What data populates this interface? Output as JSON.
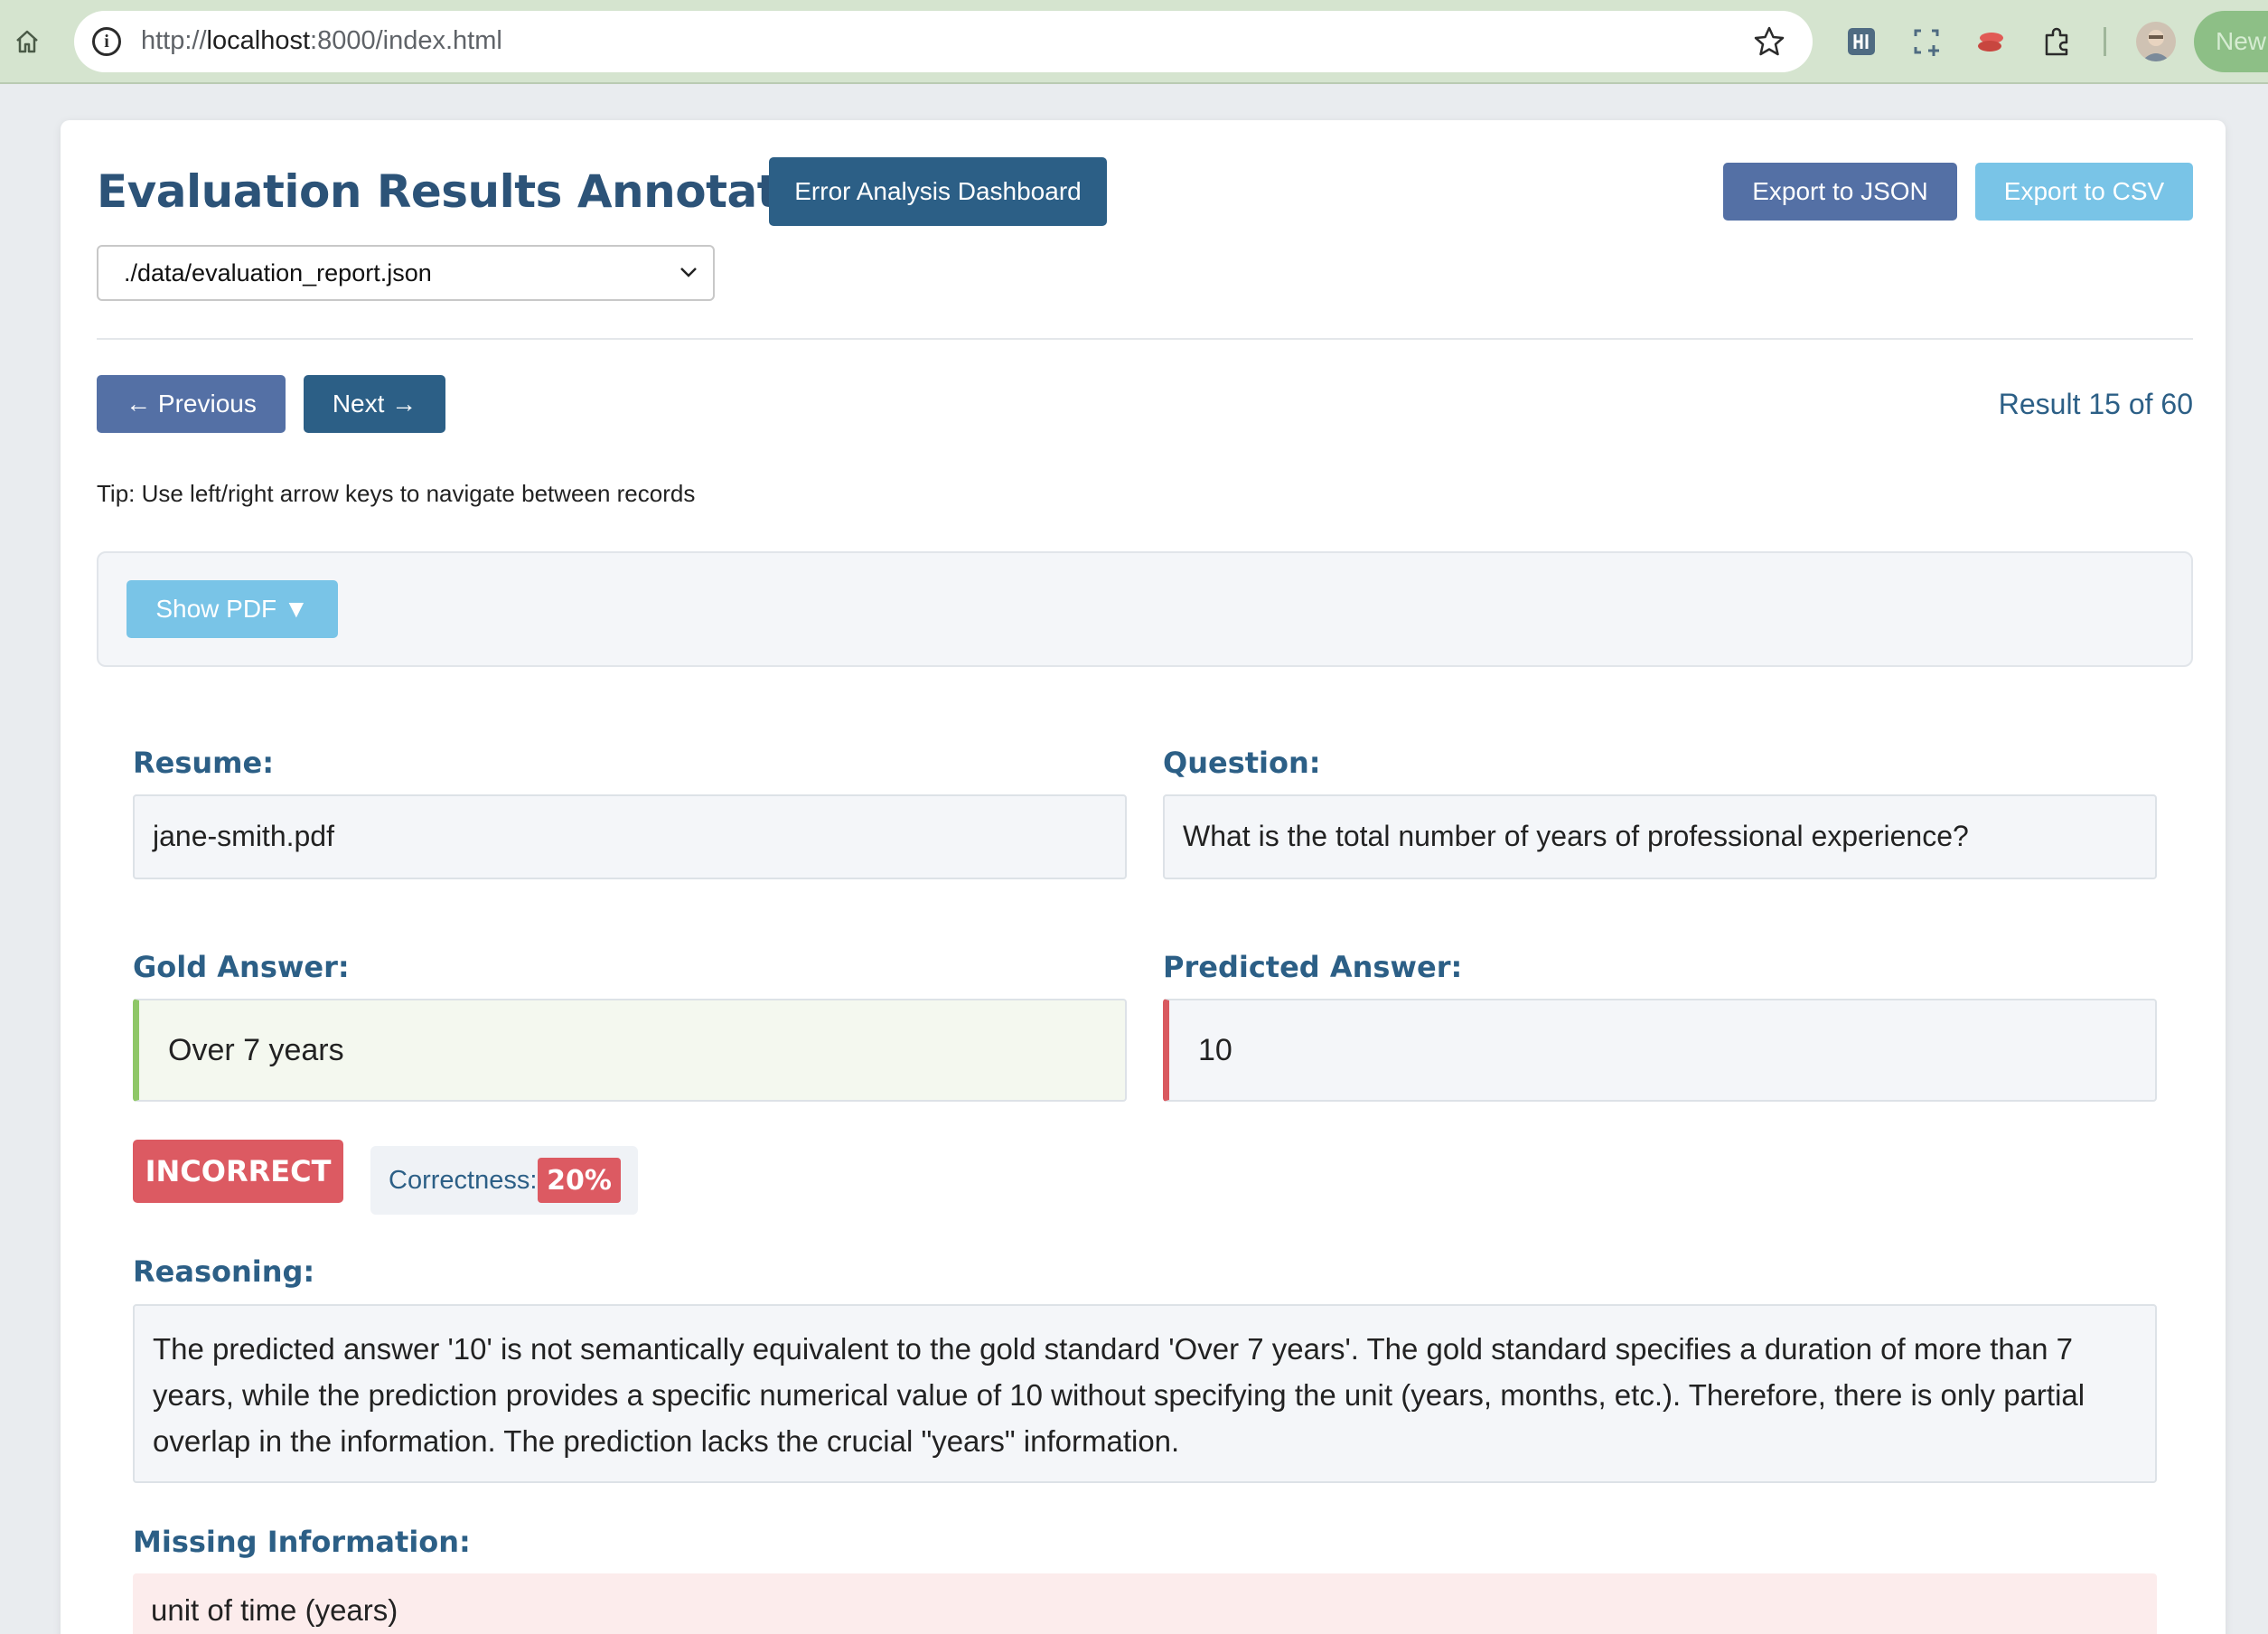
{
  "browser": {
    "url_prefix": "http://",
    "url_host": "localhost",
    "url_rest": ":8000/index.html",
    "new_tab_label": "New"
  },
  "app": {
    "title": "Evaluation Results Annotator",
    "dashboard_button": "Error Analysis Dashboard",
    "export_json": "Export to JSON",
    "export_csv": "Export to CSV",
    "file_select_value": "./data/evaluation_report.json"
  },
  "nav": {
    "previous": "← Previous",
    "next": "Next →",
    "counter": "Result 15 of 60",
    "tip": "Tip: Use left/right arrow keys to navigate between records"
  },
  "pdf": {
    "show_label": "Show PDF ▼"
  },
  "record": {
    "resume_label": "Resume:",
    "resume_value": "jane-smith.pdf",
    "question_label": "Question:",
    "question_value": "What is the total number of years of professional experience?",
    "gold_label": "Gold Answer:",
    "gold_value": "Over 7 years",
    "predicted_label": "Predicted Answer:",
    "predicted_value": "10",
    "verdict": "INCORRECT",
    "correctness_label": "Correctness:",
    "correctness_value": "20%",
    "reasoning_label": "Reasoning:",
    "reasoning_value": "The predicted answer '10' is not semantically equivalent to the gold standard 'Over 7 years'. The gold standard specifies a duration of more than 7 years, while the prediction provides a specific numerical value of 10 without specifying the unit (years, months, etc.). Therefore, there is only partial overlap in the information. The prediction lacks the crucial \"years\" information.",
    "missing_label": "Missing Information:",
    "missing_value": "unit of time (years)"
  },
  "colors": {
    "primary": "#2c5f86",
    "secondary": "#5470a5",
    "info": "#79c4e7",
    "danger": "#dc5a62",
    "success_border": "#8fc767"
  }
}
